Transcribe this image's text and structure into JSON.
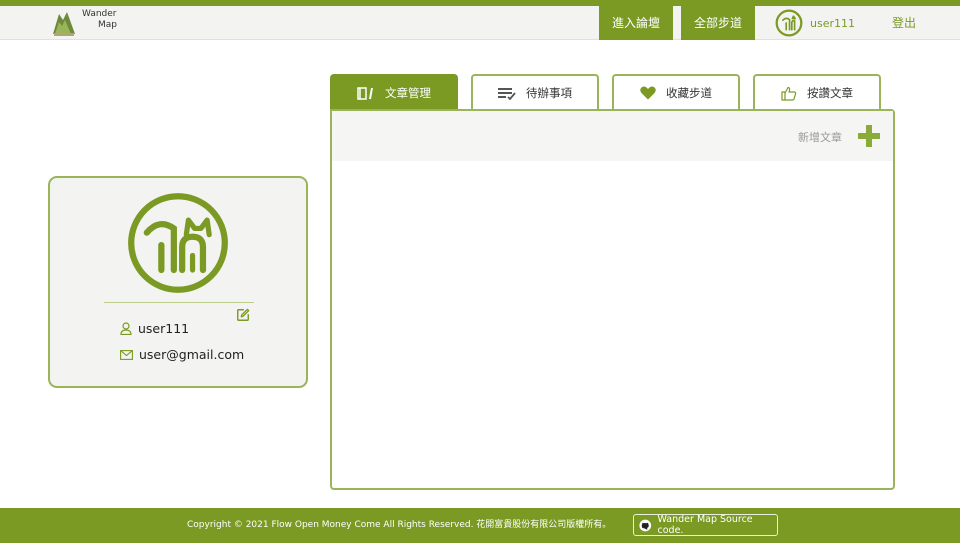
{
  "header": {
    "logo_line1": "Wander",
    "logo_line2": "Map",
    "nav_forum": "進入論壇",
    "nav_trails": "全部步道",
    "user_name": "user111",
    "logout": "登出"
  },
  "profile": {
    "username": "user111",
    "email": "user@gmail.com"
  },
  "tabs": [
    {
      "label": "文章管理",
      "icon": "article-manage-icon",
      "active": true
    },
    {
      "label": "待辦事項",
      "icon": "todo-list-icon",
      "active": false
    },
    {
      "label": "收藏步道",
      "icon": "heart-icon",
      "active": false
    },
    {
      "label": "按讚文章",
      "icon": "thumbs-up-icon",
      "active": false
    }
  ],
  "panel": {
    "add_article_label": "新增文章"
  },
  "footer": {
    "copyright": "Copyright © 2021 Flow Open Money Come All Rights Reserved. 花開富貴股份有限公司版權所有。",
    "source_label": "Wander Map Source code."
  },
  "colors": {
    "brand_green": "#7a9a24",
    "border_green": "#9ab45a",
    "card_bg": "#f3f3f1"
  }
}
